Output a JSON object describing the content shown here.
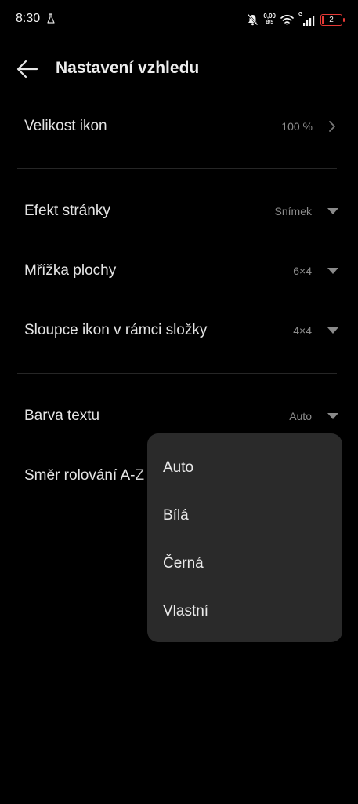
{
  "status_bar": {
    "time": "8:30",
    "net_speed_value": "0,00",
    "net_speed_unit": "B/S",
    "network_type": "G",
    "battery_level": "2",
    "battery_color": "#e53935"
  },
  "header": {
    "title": "Nastavení vzhledu"
  },
  "settings": {
    "icon_size": {
      "label": "Velikost ikon",
      "value": "100 %"
    },
    "page_effect": {
      "label": "Efekt stránky",
      "value": "Snímek"
    },
    "desktop_grid": {
      "label": "Mřížka plochy",
      "value": "6×4"
    },
    "folder_icon_columns": {
      "label": "Sloupce ikon v rámci složky",
      "value": "4×4"
    },
    "text_color": {
      "label": "Barva textu",
      "value": "Auto"
    },
    "az_scroll_direction": {
      "label": "Směr rolování A-Z"
    }
  },
  "text_color_dropdown": {
    "options": [
      "Auto",
      "Bílá",
      "Černá",
      "Vlastní"
    ]
  },
  "icons": {
    "back": "back-arrow-icon",
    "chevron": "chevron-right-icon",
    "caret": "caret-down-icon",
    "mute": "bell-off-icon",
    "wifi": "wifi-icon",
    "signal": "signal-icon",
    "lab": "flask-icon"
  }
}
